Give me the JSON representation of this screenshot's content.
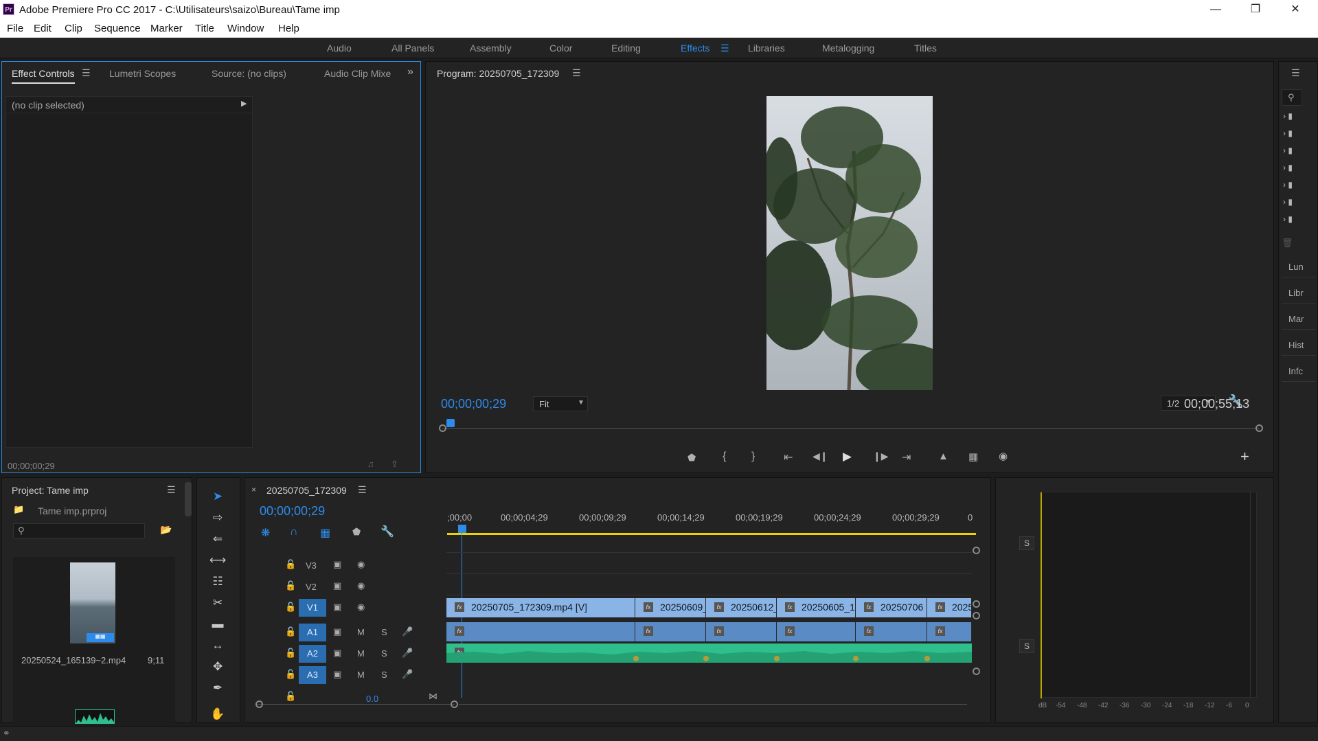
{
  "app": {
    "window_title": "Adobe Premiere Pro CC 2017 - C:\\Utilisateurs\\saizo\\Bureau\\Tame imp",
    "logo_text": "Pr"
  },
  "menu": [
    "File",
    "Edit",
    "Clip",
    "Sequence",
    "Marker",
    "Title",
    "Window",
    "Help"
  ],
  "workspaces": {
    "items": [
      "Audio",
      "All Panels",
      "Assembly",
      "Color",
      "Editing",
      "Effects",
      "Libraries",
      "Metalogging",
      "Titles"
    ],
    "active": "Effects"
  },
  "effect_controls": {
    "tabs": [
      "Effect Controls",
      "Lumetri Scopes",
      "Source: (no clips)",
      "Audio Clip Mixe"
    ],
    "no_clip": "(no clip selected)",
    "timecode": "00;00;00;29"
  },
  "program_monitor": {
    "title": "Program: 20250705_172309",
    "current_time": "00;00;00;29",
    "fit": "Fit",
    "resolution": "1/2",
    "duration": "00;00;55;13",
    "playhead_fraction": 0.01
  },
  "project": {
    "title": "Project: Tame imp",
    "file": "Tame imp.prproj",
    "search_placeholder": "",
    "item_name": "20250524_165139~2.mp4",
    "item_duration": "9;11"
  },
  "timeline": {
    "sequence_name": "20250705_172309",
    "current_time": "00;00;00;29",
    "ruler_labels": [
      ";00;00",
      "00;00;04;29",
      "00;00;09;29",
      "00;00;14;29",
      "00;00;19;29",
      "00;00;24;29",
      "00;00;29;29",
      "0"
    ],
    "video_tracks": [
      "V3",
      "V2",
      "V1"
    ],
    "audio_tracks": [
      "A1",
      "A2",
      "A3"
    ],
    "master_volume": "0.0",
    "clips": [
      {
        "name": "20250705_172309.mp4 [V]"
      },
      {
        "name": "20250609_"
      },
      {
        "name": "20250612_"
      },
      {
        "name": "20250605_1"
      },
      {
        "name": "20250706"
      },
      {
        "name": "2025"
      }
    ],
    "mute_label": "M",
    "solo_label": "S"
  },
  "audio_meter": {
    "solo_label": "S",
    "scale": [
      "dB",
      "-54",
      "-48",
      "-42",
      "-36",
      "-30",
      "-24",
      "-18",
      "-12",
      "-6",
      "0"
    ]
  },
  "right_panel": {
    "tabs": [
      "Lun",
      "Libr",
      "Mar",
      "Hist",
      "Infc"
    ]
  }
}
